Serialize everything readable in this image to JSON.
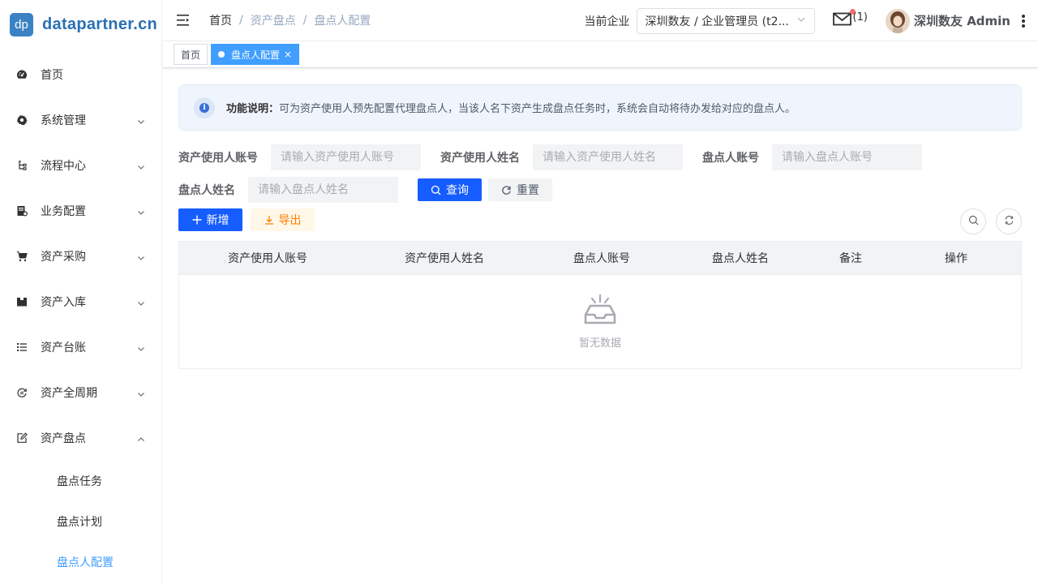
{
  "app": {
    "logo_badge": "dp",
    "logo_text": "datapartner.cn"
  },
  "sidebar": {
    "items": [
      {
        "label": "首页",
        "icon": "dashboard-icon",
        "has_arrow": false
      },
      {
        "label": "系统管理",
        "icon": "gear-icon",
        "has_arrow": true
      },
      {
        "label": "流程中心",
        "icon": "flow-icon",
        "has_arrow": true
      },
      {
        "label": "业务配置",
        "icon": "document-icon",
        "has_arrow": true
      },
      {
        "label": "资产采购",
        "icon": "cart-icon",
        "has_arrow": true
      },
      {
        "label": "资产入库",
        "icon": "box-icon",
        "has_arrow": true
      },
      {
        "label": "资产台账",
        "icon": "list-icon",
        "has_arrow": true
      },
      {
        "label": "资产全周期",
        "icon": "cycle-icon",
        "has_arrow": true
      },
      {
        "label": "资产盘点",
        "icon": "edit-icon",
        "has_arrow": true,
        "expanded": true
      }
    ],
    "sub_items": [
      {
        "label": "盘点任务",
        "active": false
      },
      {
        "label": "盘点计划",
        "active": false
      },
      {
        "label": "盘点人配置",
        "active": true
      }
    ]
  },
  "header": {
    "breadcrumb": [
      "首页",
      "资产盘点",
      "盘点人配置"
    ],
    "company_label": "当前企业",
    "company_value": "深圳数友 / 企业管理员 (t2...",
    "mail_count": "(1)",
    "username": "深圳数友 Admin"
  },
  "tags": {
    "home": "首页",
    "active": "盘点人配置",
    "close": "×"
  },
  "notice": {
    "title": "功能说明：",
    "text": "可为资产使用人预先配置代理盘点人，当该人名下资产生成盘点任务时，系统会自动将待办发给对应的盘点人。"
  },
  "filters": {
    "user_account_label": "资产使用人账号",
    "user_account_placeholder": "请输入资产使用人账号",
    "user_name_label": "资产使用人姓名",
    "user_name_placeholder": "请输入资产使用人姓名",
    "checker_account_label": "盘点人账号",
    "checker_account_placeholder": "请输入盘点人账号",
    "checker_name_label": "盘点人姓名",
    "checker_name_placeholder": "请输入盘点人姓名",
    "query_label": "查询",
    "reset_label": "重置"
  },
  "toolbar": {
    "add_label": "新增",
    "export_label": "导出"
  },
  "table": {
    "columns": [
      "资产使用人账号",
      "资产使用人姓名",
      "盘点人账号",
      "盘点人姓名",
      "备注",
      "操作"
    ],
    "empty_text": "暂无数据"
  },
  "colors": {
    "primary": "#165dff",
    "active_tag": "#409eff",
    "warn": "#ff7d00"
  }
}
